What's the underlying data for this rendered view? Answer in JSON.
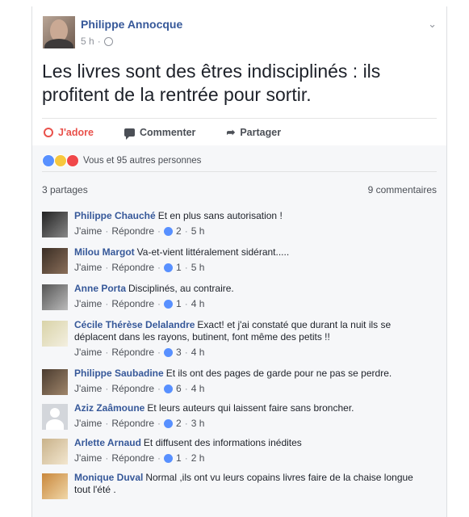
{
  "post": {
    "author": "Philippe Annocque",
    "time": "5 h",
    "text": "Les livres sont des êtres indisciplinés : ils profitent de la rentrée pour sortir.",
    "actions": {
      "like": "J'adore",
      "comment": "Commenter",
      "share": "Partager"
    },
    "reactions_text": "Vous et 95 autres personnes",
    "shares_text": "3 partages",
    "comments_count_text": "9 commentaires"
  },
  "link_labels": {
    "like": "J'aime",
    "reply": "Répondre"
  },
  "comments": [
    {
      "author": "Philippe Chauché",
      "text": "Et en plus sans autorisation !",
      "likes": "2",
      "time": "5 h"
    },
    {
      "author": "Milou Margot",
      "text": "Va-et-vient littéralement sidérant.....",
      "likes": "1",
      "time": "5 h"
    },
    {
      "author": "Anne Porta",
      "text": "Disciplinés, au contraire.",
      "likes": "1",
      "time": "4 h"
    },
    {
      "author": "Cécile Thérèse Delalandre",
      "text": "Exact! et j'ai constaté que durant la nuit ils se déplacent dans les rayons, butinent, font même des petits !!",
      "likes": "3",
      "time": "4 h"
    },
    {
      "author": "Philippe Saubadine",
      "text": "Et ils ont des pages de garde pour ne pas se perdre.",
      "likes": "6",
      "time": "4 h"
    },
    {
      "author": "Aziz Zaâmoune",
      "text": "Et leurs auteurs qui laissent faire sans broncher.",
      "likes": "2",
      "time": "3 h"
    },
    {
      "author": "Arlette Arnaud",
      "text": "Et diffusent des informations inédites",
      "likes": "1",
      "time": "2 h"
    },
    {
      "author": "Monique Duval",
      "text": "Normal ,ils ont vu leurs copains livres faire de la chaise longue tout l'été .",
      "likes": "",
      "time": ""
    }
  ],
  "colors": {
    "link_blue": "#365899",
    "love_red": "#e9514b",
    "like_blue": "#5890ff"
  }
}
